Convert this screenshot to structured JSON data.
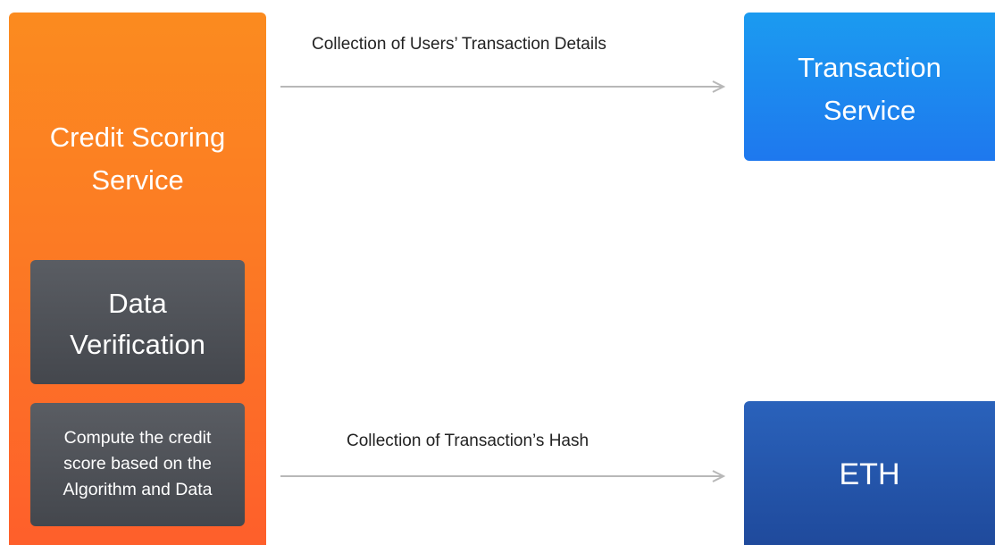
{
  "credit_service": {
    "title_line1": "Credit Scoring",
    "title_line2": "Service"
  },
  "data_verification": {
    "line1": "Data",
    "line2": "Verification"
  },
  "compute": {
    "line1": "Compute the credit",
    "line2": "score based on the",
    "line3": "Algorithm and Data"
  },
  "transaction_service": {
    "line1": "Transaction",
    "line2": "Service"
  },
  "eth": {
    "label": "ETH"
  },
  "arrows": {
    "top_label": "Collection of Users’ Transaction Details",
    "bottom_label": "Collection of Transaction’s Hash"
  },
  "colors": {
    "orange": "#fc7a24",
    "dark_gray": "#4e5157",
    "light_blue": "#1e8cef",
    "dark_blue": "#2456ab",
    "arrow": "#b5b5b5"
  }
}
